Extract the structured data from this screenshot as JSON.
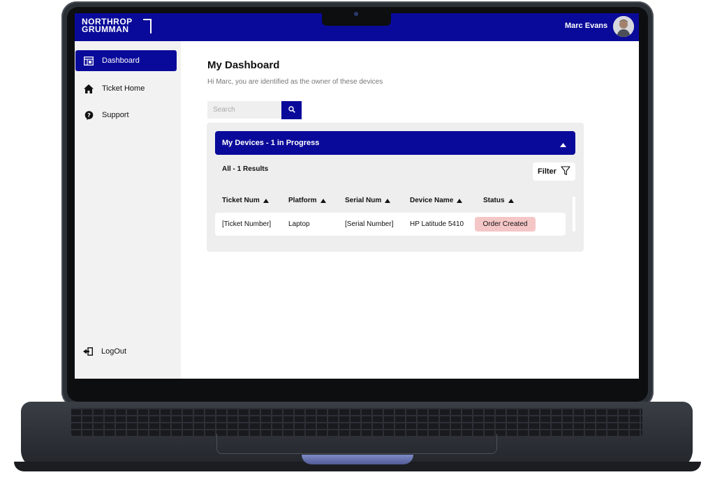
{
  "brand": {
    "line1": "NORTHROP",
    "line2": "GRUMMAN"
  },
  "header": {
    "user_name": "Marc Evans"
  },
  "sidebar": {
    "items": [
      {
        "label": "Dashboard",
        "icon": "dashboard-icon",
        "active": true
      },
      {
        "label": "Ticket Home",
        "icon": "home-icon",
        "active": false
      },
      {
        "label": "Support",
        "icon": "support-icon",
        "active": false
      }
    ],
    "logout": {
      "label": "LogOut",
      "icon": "logout-icon"
    }
  },
  "main": {
    "title": "My Dashboard",
    "subtitle": "Hi Marc, you are identified as the owner of these devices",
    "search": {
      "placeholder": "Search",
      "value": ""
    },
    "panel": {
      "accordion_title": "My Devices - 1 in Progress",
      "results_label": "All - 1 Results",
      "filter_label": "Filter",
      "columns": [
        "Ticket Num",
        "Platform",
        "Serial Num",
        "Device Name",
        "Status"
      ],
      "rows": [
        {
          "ticket": "[Ticket Number]",
          "platform": "Laptop",
          "serial": "[Serial Number]",
          "device": "HP Latitude 5410",
          "status": "Order Created"
        }
      ]
    }
  },
  "colors": {
    "brand_blue": "#0a0a9a",
    "status_badge": "#f5c6c6",
    "sidebar_bg": "#f2f2f2",
    "panel_bg": "#eeeeee"
  }
}
